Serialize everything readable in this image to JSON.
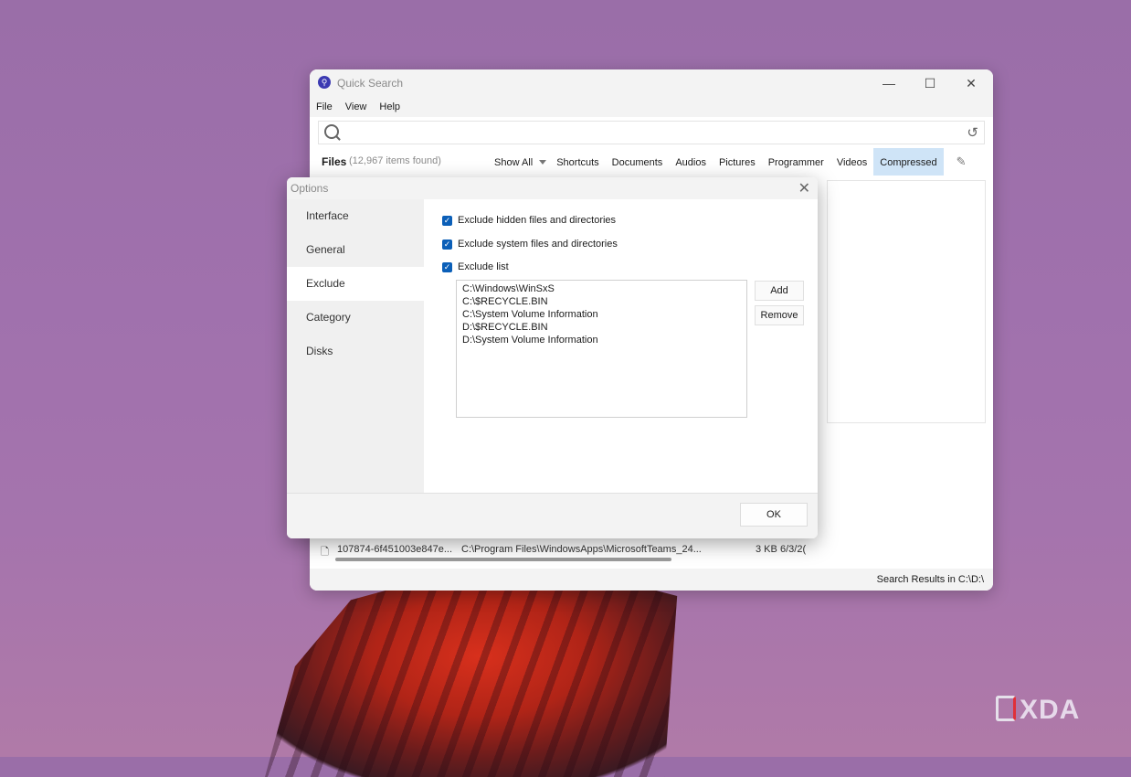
{
  "main_window": {
    "title": "Quick Search",
    "app_icon": "search-icon",
    "controls": {
      "minimize": "—",
      "maximize": "☐",
      "close": "✕"
    },
    "menu": [
      "File",
      "View",
      "Help"
    ],
    "search_placeholder": "",
    "files_label": "Files",
    "files_count": "(12,967 items found)",
    "categories": [
      "Show All",
      "Shortcuts",
      "Documents",
      "Audios",
      "Pictures",
      "Programmer",
      "Videos",
      "Compressed"
    ],
    "active_category": "Compressed",
    "result_row": {
      "name": "107874-6f451003e847e...",
      "path": "C:\\Program Files\\WindowsApps\\MicrosoftTeams_24...",
      "size": "3 KB",
      "date": "6/3/2("
    },
    "status": "Search Results in C:\\D:\\"
  },
  "options_dialog": {
    "title": "Options",
    "close": "✕",
    "sidebar": [
      "Interface",
      "General",
      "Exclude",
      "Category",
      "Disks"
    ],
    "active_sidebar": "Exclude",
    "checkboxes": [
      {
        "label": "Exclude hidden files and directories",
        "checked": true
      },
      {
        "label": "Exclude system files and directories",
        "checked": true
      },
      {
        "label": "Exclude list",
        "checked": true
      }
    ],
    "exclude_list": [
      "C:\\Windows\\WinSxS",
      "C:\\$RECYCLE.BIN",
      "C:\\System Volume Information",
      "D:\\$RECYCLE.BIN",
      "D:\\System Volume Information"
    ],
    "add_label": "Add",
    "remove_label": "Remove",
    "ok_label": "OK"
  },
  "watermark": "XDA",
  "colors": {
    "accent": "#0b5fb8",
    "active_tab": "#cfe4f7",
    "app_icon": "#3c3ab2"
  }
}
